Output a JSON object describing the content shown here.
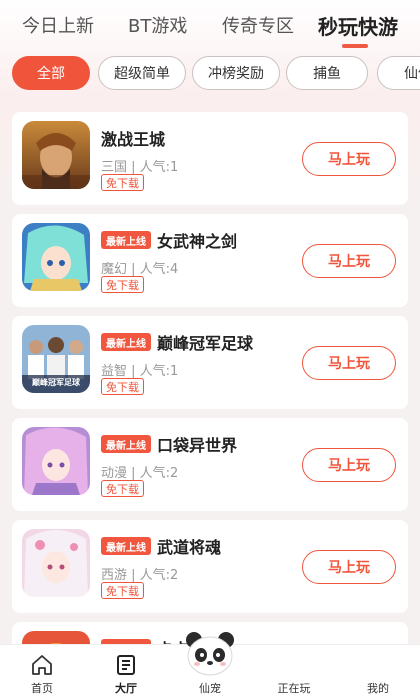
{
  "tabs": [
    {
      "label": "今日上新",
      "active": false
    },
    {
      "label": "BT游戏",
      "active": false
    },
    {
      "label": "传奇专区",
      "active": false
    },
    {
      "label": "秒玩快游",
      "active": true
    }
  ],
  "chips": [
    {
      "label": "全部",
      "active": true
    },
    {
      "label": "超级简单",
      "active": false
    },
    {
      "label": "冲榜奖励",
      "active": false
    },
    {
      "label": "捕鱼",
      "active": false
    },
    {
      "label": "仙侠",
      "active": false
    }
  ],
  "games": [
    {
      "title": "激战王城",
      "badge": "",
      "meta": "三国 | 人气:1",
      "tag": "免下载",
      "button": "马上玩",
      "icon": "warrior-portrait"
    },
    {
      "title": "女武神之剑",
      "badge": "最新上线",
      "meta": "魔幻 | 人气:4",
      "tag": "免下载",
      "button": "马上玩",
      "icon": "anime-girl-portrait"
    },
    {
      "title": "巅峰冠军足球",
      "badge": "最新上线",
      "meta": "益智 | 人气:1",
      "tag": "免下载",
      "button": "马上玩",
      "icon": "football-team-portrait",
      "icon_text": "巅峰冠军足球"
    },
    {
      "title": "口袋异世界",
      "badge": "最新上线",
      "meta": "动漫 | 人气:2",
      "tag": "免下载",
      "button": "马上玩",
      "icon": "pink-hair-girl-portrait"
    },
    {
      "title": "武道将魂",
      "badge": "最新上线",
      "meta": "西游 | 人气:2",
      "tag": "免下载",
      "button": "马上玩",
      "icon": "white-hair-girl-portrait"
    },
    {
      "title": "卡卡保皇",
      "badge": "最新上线",
      "meta": "",
      "tag": "",
      "button": "",
      "icon": "card-game-icon"
    }
  ],
  "bottom_nav": [
    {
      "label": "首页",
      "icon": "home-icon",
      "active": false
    },
    {
      "label": "大厅",
      "icon": "hall-icon",
      "active": true
    },
    {
      "label": "仙宠",
      "icon": "panda-icon",
      "active": false
    },
    {
      "label": "正在玩",
      "icon": "playing-icon",
      "active": false
    },
    {
      "label": "我的",
      "icon": "profile-icon",
      "active": false
    }
  ],
  "colors": {
    "accent": "#f0553c",
    "badge": "#f1573f",
    "background": "#f5f1f0"
  }
}
